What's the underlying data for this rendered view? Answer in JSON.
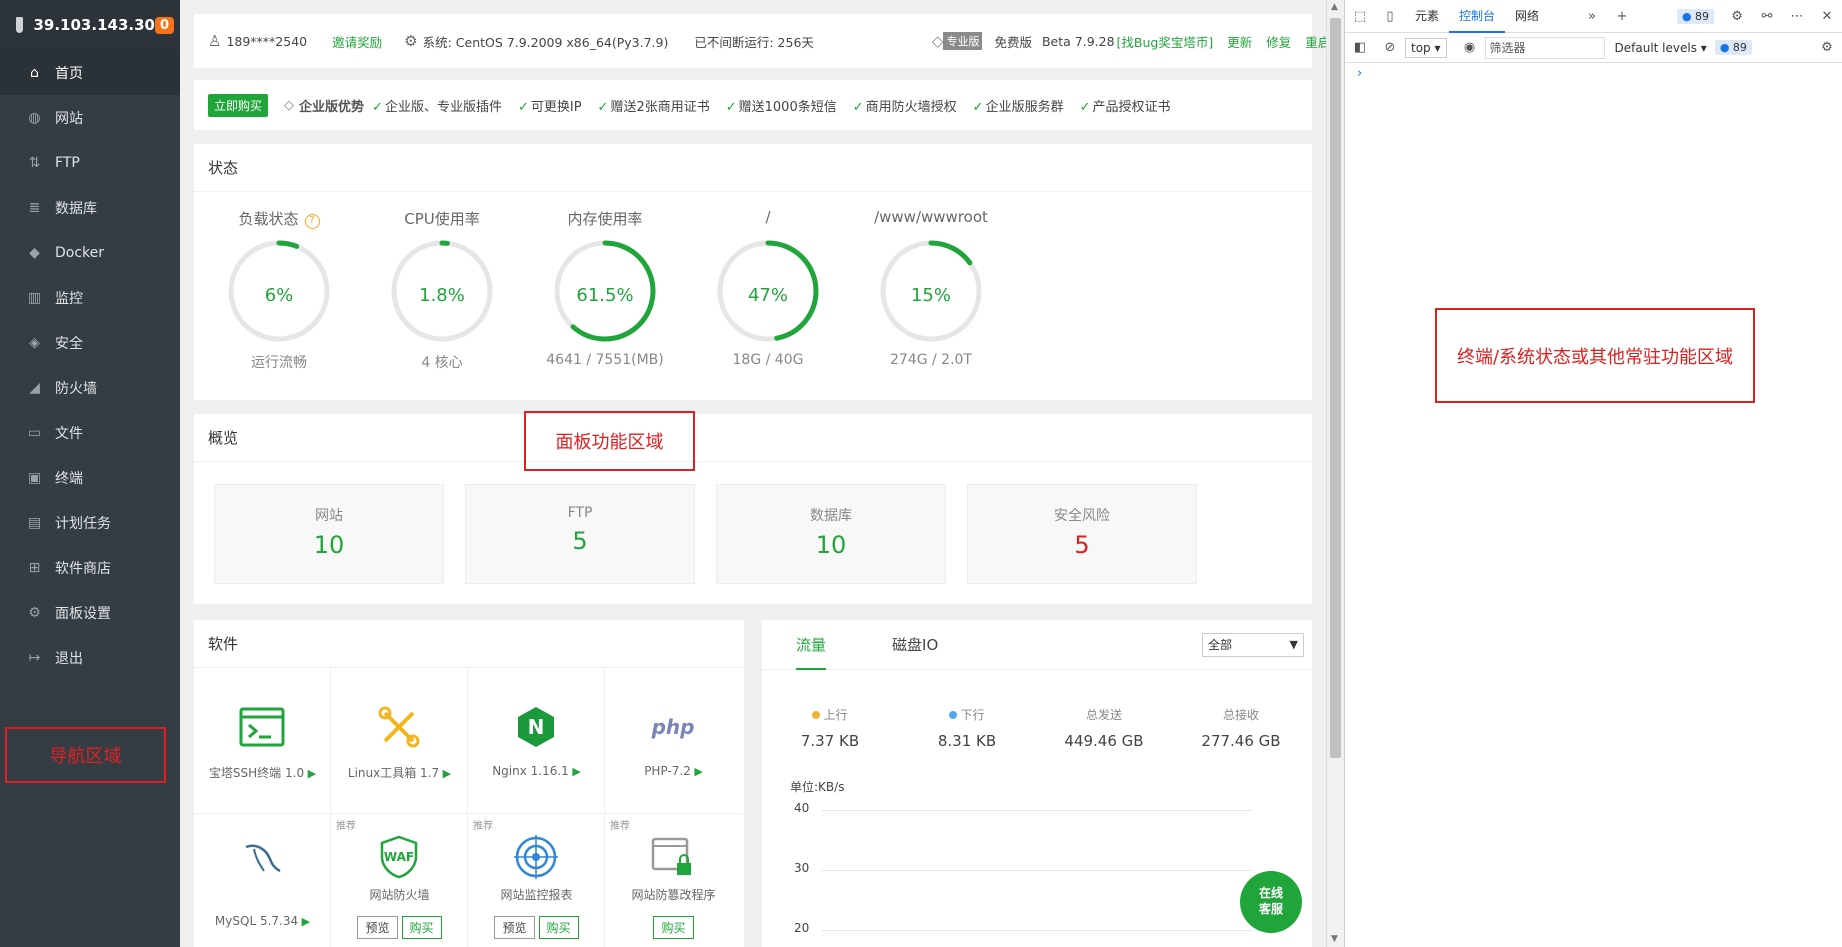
{
  "sidebar": {
    "server_ip": "39.103.143.30",
    "msg_count": "0",
    "items": [
      {
        "icon": "⌂",
        "label": "首页",
        "name": "home"
      },
      {
        "icon": "◍",
        "label": "网站",
        "name": "website"
      },
      {
        "icon": "⇅",
        "label": "FTP",
        "name": "ftp"
      },
      {
        "icon": "≣",
        "label": "数据库",
        "name": "database"
      },
      {
        "icon": "◆",
        "label": "Docker",
        "name": "docker"
      },
      {
        "icon": "▥",
        "label": "监控",
        "name": "monitor"
      },
      {
        "icon": "◈",
        "label": "安全",
        "name": "security"
      },
      {
        "icon": "◢",
        "label": "防火墙",
        "name": "firewall"
      },
      {
        "icon": "▭",
        "label": "文件",
        "name": "files"
      },
      {
        "icon": "▣",
        "label": "终端",
        "name": "terminal"
      },
      {
        "icon": "▤",
        "label": "计划任务",
        "name": "cron"
      },
      {
        "icon": "⊞",
        "label": "软件商店",
        "name": "store"
      },
      {
        "icon": "⚙",
        "label": "面板设置",
        "name": "settings"
      },
      {
        "icon": "↦",
        "label": "退出",
        "name": "logout"
      }
    ]
  },
  "annotations": {
    "nav": "导航区域",
    "panel": "面板功能区域",
    "devtools": "终端/系统状态或其他常驻功能区域"
  },
  "topbar": {
    "user": "189****2540",
    "invite": "邀请奖励",
    "system": "系统:  CentOS 7.9.2009 x86_64(Py3.7.9)",
    "uptime": "已不间断运行: 256天",
    "pro_badge": "专业版",
    "free": "免费版",
    "version": "Beta 7.9.28",
    "bug": "[找Bug奖宝塔币]",
    "update": "更新",
    "repair": "修复",
    "restart": "重启"
  },
  "promo": {
    "buy": "立即购买",
    "enterprise": "企业版优势",
    "features": [
      "企业版、专业版插件",
      "可更换IP",
      "赠送2张商用证书",
      "赠送1000条短信",
      "商用防火墙授权",
      "企业版服务群",
      "产品授权证书"
    ]
  },
  "state": {
    "title": "状态",
    "gauges": [
      {
        "label": "负载状态",
        "value": "6%",
        "percent": 6,
        "sub": "运行流畅",
        "help": "?"
      },
      {
        "label": "CPU使用率",
        "value": "1.8%",
        "percent": 1.8,
        "sub": "4 核心"
      },
      {
        "label": "内存使用率",
        "value": "61.5%",
        "percent": 61.5,
        "sub": "4641 / 7551(MB)"
      },
      {
        "label": "/",
        "value": "47%",
        "percent": 47,
        "sub": "18G / 40G"
      },
      {
        "label": "/www/wwwroot",
        "value": "15%",
        "percent": 15,
        "sub": "274G / 2.0T"
      }
    ]
  },
  "overview": {
    "title": "概览",
    "boxes": [
      {
        "label": "网站",
        "value": "10"
      },
      {
        "label": "FTP",
        "value": "5"
      },
      {
        "label": "数据库",
        "value": "10"
      },
      {
        "label": "安全风险",
        "value": "5"
      }
    ]
  },
  "software": {
    "title": "软件",
    "items": [
      {
        "name": "宝塔SSH终端 1.0",
        "icon": "terminal-icon"
      },
      {
        "name": "Linux工具箱 1.7",
        "icon": "tools-icon"
      },
      {
        "name": "Nginx 1.16.1",
        "icon": "nginx-icon"
      },
      {
        "name": "PHP-7.2",
        "icon": "php-icon"
      },
      {
        "name": "MySQL 5.7.34",
        "icon": "mysql-icon"
      },
      {
        "name": "网站防火墙",
        "icon": "waf-icon",
        "rec": "推荐",
        "b1": "预览",
        "b2": "购买"
      },
      {
        "name": "网站监控报表",
        "icon": "monitor-report-icon",
        "rec": "推荐",
        "b1": "预览",
        "b2": "购买"
      },
      {
        "name": "网站防篡改程序",
        "icon": "tamper-icon",
        "rec": "推荐",
        "b2": "购买"
      }
    ],
    "php_logo": "php",
    "waf_logo": "WAF",
    "nginx_logo": "N"
  },
  "traffic": {
    "tab1": "流量",
    "tab2": "磁盘IO",
    "select": "全部",
    "stats": [
      {
        "label": "上行",
        "value": "7.37 KB",
        "dot": "#f2b33d"
      },
      {
        "label": "下行",
        "value": "8.31 KB",
        "dot": "#52a8f0"
      },
      {
        "label": "总发送",
        "value": "449.46 GB"
      },
      {
        "label": "总接收",
        "value": "277.46 GB"
      }
    ],
    "unit": "单位:KB/s",
    "yticks": [
      "40",
      "30",
      "20"
    ]
  },
  "online": {
    "line1": "在线",
    "line2": "客服"
  },
  "devtools": {
    "tabs": [
      "元素",
      "控制台",
      "网络"
    ],
    "active_tab": "控制台",
    "issues": "89",
    "context": "top",
    "filter": "筛选器",
    "levels": "Default levels",
    "issues2": "89",
    "prompt": "›"
  },
  "colors": {
    "accent": "#20a53a",
    "sidebar": "#353d44",
    "danger": "#e02020",
    "annotation": "#e02020"
  }
}
